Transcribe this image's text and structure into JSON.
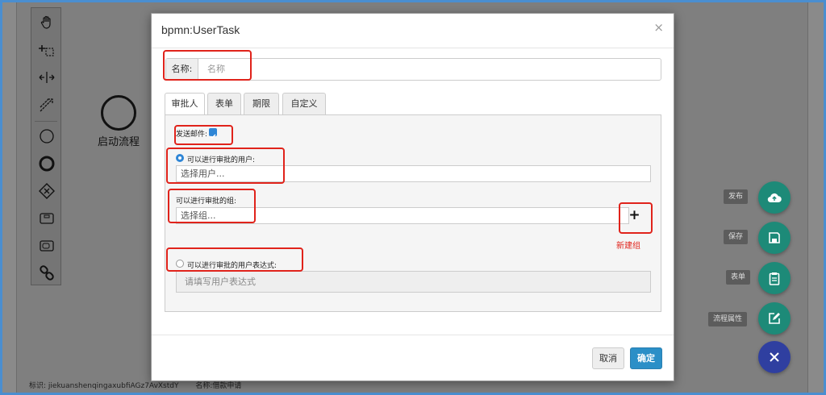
{
  "canvas": {
    "start_event_label": "启动流程",
    "status_id_label": "标识:",
    "status_id_value": "jiekuanshenqingaxubfiAGz7AvXstdY",
    "status_name_label": "名称:借款申请"
  },
  "palette": {
    "tools": [
      "hand-tool-icon",
      "lasso-tool-icon",
      "space-tool-icon",
      "connect-tool-icon",
      "start-event-icon",
      "end-event-icon",
      "gateway-icon",
      "task-icon",
      "subprocess-icon",
      "link-icon"
    ]
  },
  "fabs": [
    {
      "label": "发布",
      "icon": "cloud-upload-icon",
      "color": "#1d8a78"
    },
    {
      "label": "保存",
      "icon": "save-icon",
      "color": "#1d8a78"
    },
    {
      "label": "表单",
      "icon": "clipboard-icon",
      "color": "#1d8a78"
    },
    {
      "label": "流程属性",
      "icon": "edit-icon",
      "color": "#1d8a78"
    },
    {
      "label": "",
      "icon": "close-icon",
      "color": "#2f3fa0"
    }
  ],
  "modal": {
    "title": "bpmn:UserTask",
    "name_label": "名称:",
    "name_placeholder": "名称",
    "tabs": [
      "审批人",
      "表单",
      "期限",
      "自定义"
    ],
    "active_tab": "审批人",
    "send_mail_label": "发送邮件:",
    "send_mail_checked": true,
    "users_radio_label": "可以进行审批的用户:",
    "users_placeholder": "选择用户...",
    "groups_label": "可以进行审批的组:",
    "groups_placeholder": "选择组...",
    "new_group_annotation": "新建组",
    "expression_radio_label": "可以进行审批的用户表达式:",
    "expression_placeholder": "请填写用户表达式",
    "cancel_label": "取消",
    "ok_label": "确定"
  },
  "colors": {
    "annotation_red": "#e0231b",
    "primary_blue": "#2b8fc7",
    "fab_green": "#1d8a78",
    "fab_indigo": "#2f3fa0"
  }
}
